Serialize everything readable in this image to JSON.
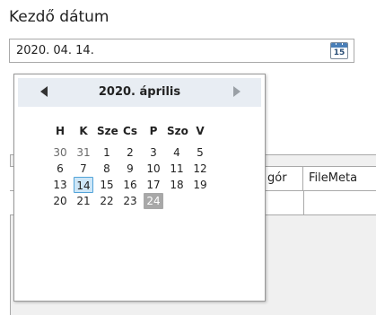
{
  "title": "Kezdő dátum",
  "date_input": {
    "value": "2020. 04. 14.",
    "calendar_button_number": "15"
  },
  "grid": {
    "columns": [
      "gór",
      "FileMeta"
    ]
  },
  "calendar": {
    "month_label": "2020. április",
    "weekdays": [
      "H",
      "K",
      "Sze",
      "Cs",
      "P",
      "Szo",
      "V"
    ],
    "weeks": [
      [
        "30",
        "31",
        "1",
        "2",
        "3",
        "4",
        "5"
      ],
      [
        "6",
        "7",
        "8",
        "9",
        "10",
        "11",
        "12"
      ],
      [
        "13",
        "14",
        "15",
        "16",
        "17",
        "18",
        "19"
      ],
      [
        "20",
        "21",
        "22",
        "23",
        "24"
      ]
    ],
    "today": "14",
    "selected": "24",
    "colors": {
      "header_bg": "#e8edf3",
      "today_bg": "#cde6f7",
      "today_border": "#52a3d9",
      "selected_bg": "#a8a8a8"
    }
  }
}
